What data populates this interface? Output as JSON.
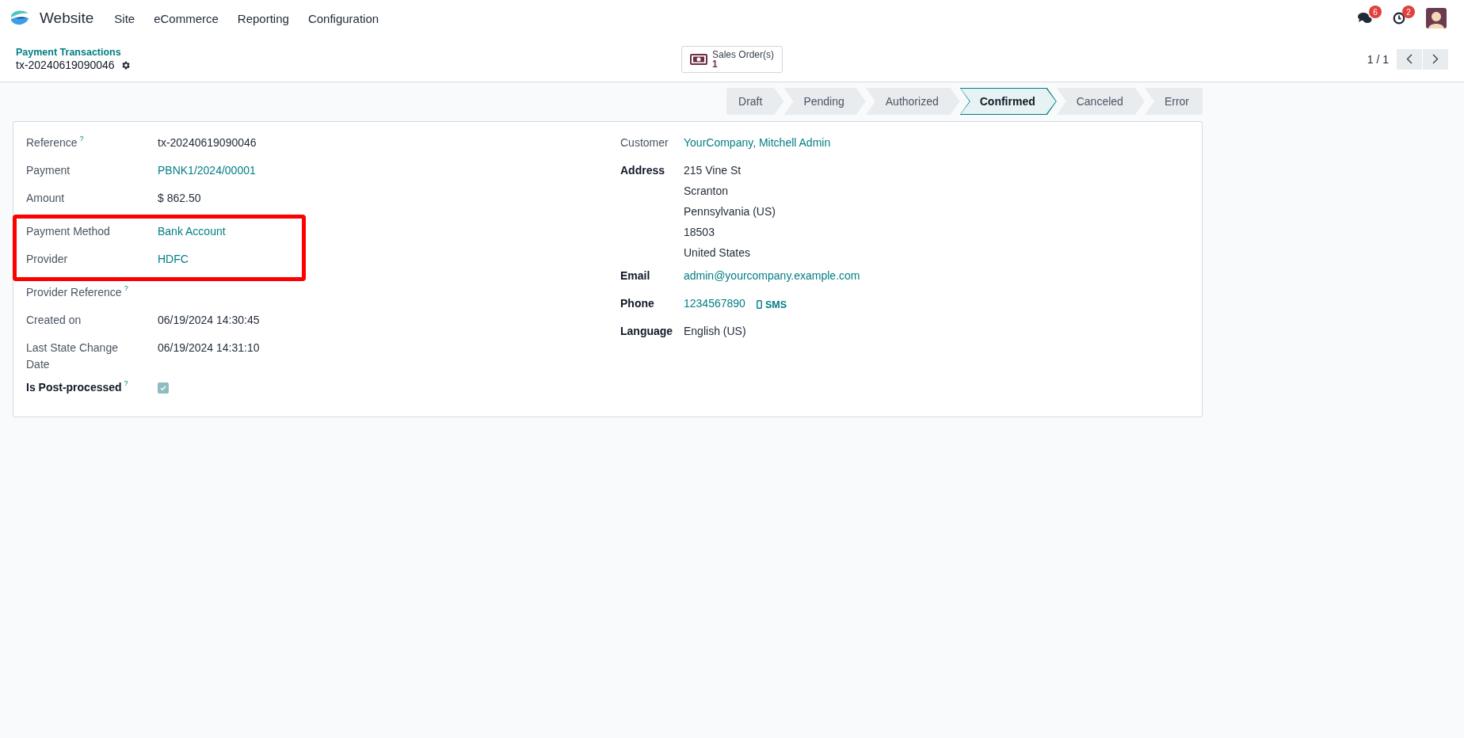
{
  "navbar": {
    "app_name": "Website",
    "menu": [
      "Site",
      "eCommerce",
      "Reporting",
      "Configuration"
    ],
    "messages_count": "6",
    "activities_count": "2"
  },
  "control_panel": {
    "breadcrumb": "Payment Transactions",
    "record_name": "tx-20240619090046",
    "smart_button": {
      "label": "Sales Order(s)",
      "count": "1"
    },
    "pager": "1 / 1"
  },
  "status_steps": [
    {
      "label": "Draft",
      "selected": false
    },
    {
      "label": "Pending",
      "selected": false
    },
    {
      "label": "Authorized",
      "selected": false
    },
    {
      "label": "Confirmed",
      "selected": true
    },
    {
      "label": "Canceled",
      "selected": false
    },
    {
      "label": "Error",
      "selected": false
    }
  ],
  "left_fields": [
    {
      "label": "Reference",
      "help": "?",
      "kind": "text",
      "value": "tx-20240619090046",
      "bold": false,
      "highlighted": false
    },
    {
      "label": "Payment",
      "kind": "link",
      "value": "PBNK1/2024/00001",
      "bold": false,
      "highlighted": false
    },
    {
      "label": "Amount",
      "kind": "text",
      "value": "$ 862.50",
      "bold": false,
      "highlighted": false
    },
    {
      "label": "Payment Method",
      "kind": "link",
      "value": "Bank Account",
      "bold": false,
      "highlighted": true
    },
    {
      "label": "Provider",
      "kind": "link",
      "value": "HDFC",
      "bold": false,
      "highlighted": true
    },
    {
      "label": "Provider Reference",
      "help": "?",
      "kind": "empty",
      "bold": false,
      "highlighted": false
    },
    {
      "label": "Created on",
      "kind": "text",
      "value": "06/19/2024 14:30:45",
      "bold": false,
      "highlighted": false
    },
    {
      "label": "Last State Change Date",
      "kind": "text",
      "value": "06/19/2024 14:31:10",
      "bold": false,
      "highlighted": false
    },
    {
      "label": "Is Post-processed",
      "help": "?",
      "kind": "checkbox",
      "checked": true,
      "bold": true,
      "highlighted": false
    }
  ],
  "right_fields": [
    {
      "label": "Customer",
      "kind": "link",
      "value": "YourCompany, Mitchell Admin",
      "bold": false
    },
    {
      "label": "Address",
      "kind": "lines",
      "lines": [
        "215 Vine St",
        "Scranton",
        "Pennsylvania (US)",
        "18503",
        "United States"
      ],
      "bold": true
    },
    {
      "label": "Email",
      "kind": "link",
      "value": "admin@yourcompany.example.com",
      "bold": true
    },
    {
      "label": "Phone",
      "kind": "phone",
      "value": "1234567890",
      "action": "SMS",
      "bold": true
    },
    {
      "label": "Language",
      "kind": "text",
      "value": "English (US)",
      "bold": true
    }
  ]
}
